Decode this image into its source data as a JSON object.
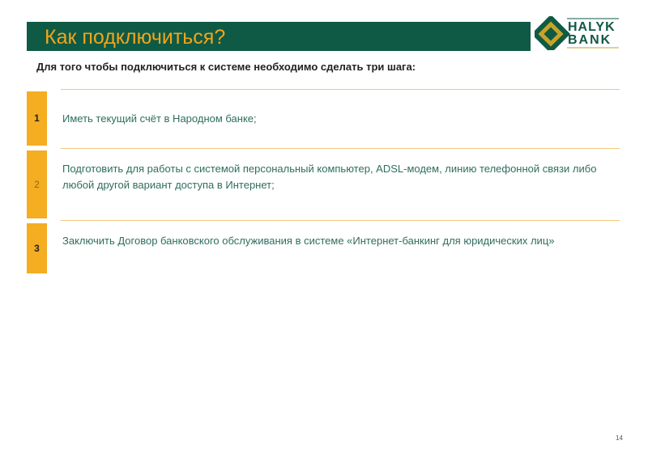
{
  "header": {
    "title": "Как подключиться?",
    "logo": {
      "text_line1": "HALYK",
      "text_line2": "BANK",
      "colors": {
        "green": "#0f5a45",
        "gold": "#c9a227",
        "text": "#0f5a45"
      }
    }
  },
  "intro": "Для того чтобы подключиться к системе необходимо сделать три шага:",
  "steps": [
    {
      "number": "1",
      "text": "Иметь текущий счёт в Народном банке;"
    },
    {
      "number": "2",
      "text": "Подготовить для работы с системой персональный компьютер, ADSL-модем, линию телефонной связи либо любой другой вариант доступа в Интернет;"
    },
    {
      "number": "3",
      "text": "Заключить Договор банковского обслуживания в системе «Интернет-банкинг для юридических лиц»"
    }
  ],
  "page_number": "14",
  "colors": {
    "title_bar": "#0f5a45",
    "title_text": "#f2a51a",
    "badge": "#f5ad22",
    "divider": "#f2c87a",
    "step_text": "#2f6e5e"
  }
}
